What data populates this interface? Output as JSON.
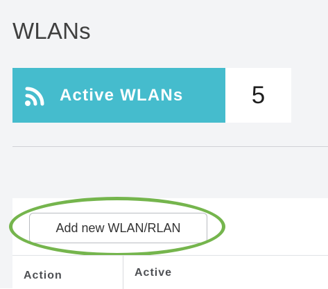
{
  "page": {
    "title": "WLANs"
  },
  "summary": {
    "icon": "wifi-signal-icon",
    "label": "Active WLANs",
    "count": "5",
    "accent_color": "#45bccd"
  },
  "actions": {
    "add_button_label": "Add new WLAN/RLAN",
    "highlight_color": "#75b54d"
  },
  "table": {
    "columns": [
      "Action",
      "Active"
    ]
  }
}
